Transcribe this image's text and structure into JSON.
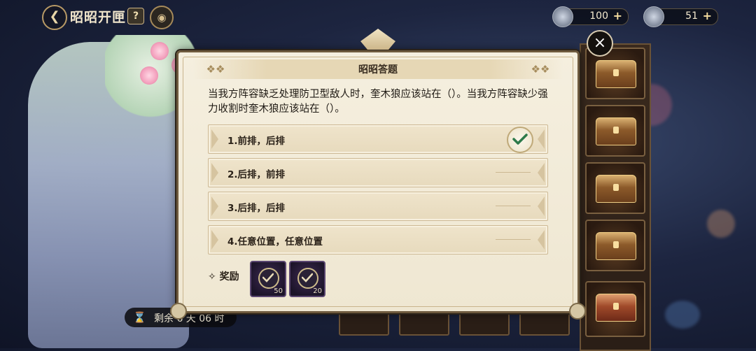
{
  "header": {
    "title": "昭昭开匣",
    "help_icon": "?",
    "back_icon": "back-arrow-icon",
    "currencies": [
      {
        "icon": "silver-coin-icon",
        "amount": "100",
        "plus": "+"
      },
      {
        "icon": "gear-coin-icon",
        "amount": "51",
        "plus": "+"
      }
    ]
  },
  "timer": {
    "text": "剩余 6 天 06 时"
  },
  "dialog": {
    "title": "昭昭答题",
    "question": "当我方阵容缺乏处理防卫型敌人时，奎木狼应该站在（）。当我方阵容缺少强力收割时奎木狼应该站在（）。",
    "options": [
      {
        "label": "1.前排，后排",
        "selected": true
      },
      {
        "label": "2.后排，前排",
        "selected": false
      },
      {
        "label": "3.后排，后排",
        "selected": false
      },
      {
        "label": "4.任意位置，任意位置",
        "selected": false
      }
    ],
    "reward_label": "奖励",
    "rewards": [
      {
        "icon": "purple-emblem-icon",
        "qty": "50"
      },
      {
        "icon": "purple-emblem-icon",
        "qty": "20"
      }
    ],
    "close_icon": "×"
  },
  "colors": {
    "panel_bg": "#f2ebd8",
    "border": "#6e5a3e",
    "check": "#2d7a4a",
    "accent_gold": "#cdbb8a"
  }
}
